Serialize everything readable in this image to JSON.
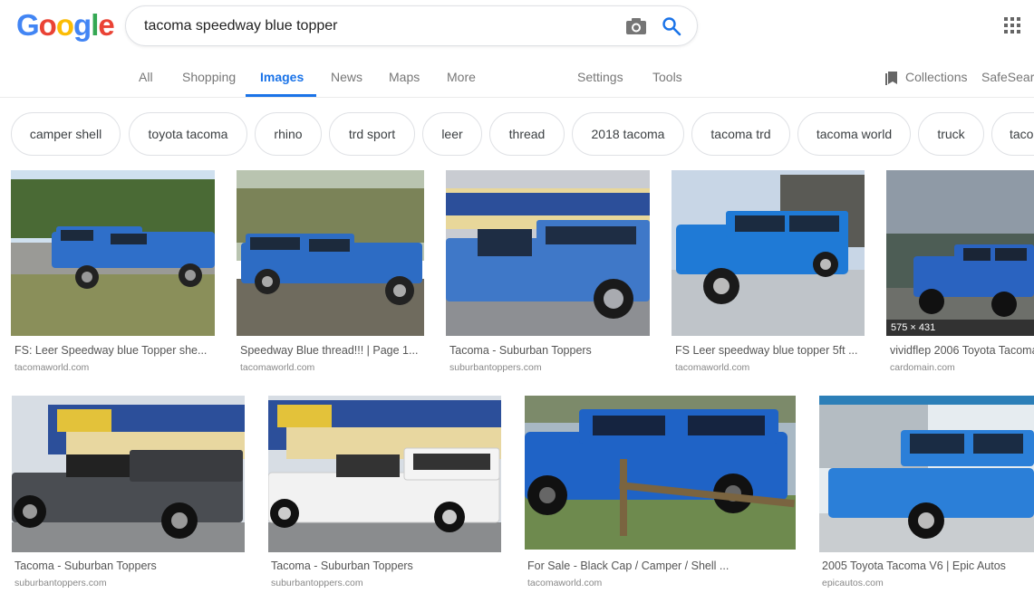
{
  "logo": {
    "letters": [
      "G",
      "o",
      "o",
      "g",
      "l",
      "e"
    ],
    "colors": [
      "#4285F4",
      "#EA4335",
      "#FBBC05",
      "#4285F4",
      "#34A853",
      "#EA4335"
    ]
  },
  "search": {
    "query": "tacoma speedway blue topper"
  },
  "tabs": {
    "all": "All",
    "shopping": "Shopping",
    "images": "Images",
    "news": "News",
    "maps": "Maps",
    "more": "More",
    "settings": "Settings",
    "tools": "Tools",
    "collections": "Collections",
    "safesearch": "SafeSearc"
  },
  "chips": [
    "camper shell",
    "toyota tacoma",
    "rhino",
    "trd sport",
    "leer",
    "thread",
    "2018 tacoma",
    "tacoma trd",
    "tacoma world",
    "truck",
    "taco"
  ],
  "results": [
    {
      "title": "FS: Leer Speedway blue Topper she...",
      "site": "tacomaworld.com",
      "truck": "#2f6fc9",
      "sky": "#cfe0ef",
      "ground": "#8a8f5a"
    },
    {
      "title": "Speedway Blue thread!!! | Page 1...",
      "site": "tacomaworld.com",
      "truck": "#2d6cc4",
      "sky": "#b9c4b0",
      "ground": "#6f6b5e"
    },
    {
      "title": "Tacoma - Suburban Toppers",
      "site": "suburbantoppers.com",
      "truck": "#3f78c8",
      "sky": "#c9ccd2",
      "ground": "#8d8f93"
    },
    {
      "title": "FS Leer speedway blue topper 5ft ...",
      "site": "tacomaworld.com",
      "truck": "#1f7ad6",
      "sky": "#c8d6e6",
      "ground": "#bfc4c9"
    },
    {
      "title": "vividflep 2006 Toyota Tacoma",
      "site": "cardomain.com",
      "truck": "#2a63c0",
      "sky": "#8f9aa6",
      "ground": "#4d5d55",
      "dims": "575 × 431"
    },
    {
      "title": "Tacoma - Suburban Toppers",
      "site": "suburbantoppers.com",
      "truck": "#4a4d52",
      "sky": "#d7dde4",
      "ground": "#8a8c8e"
    },
    {
      "title": "Tacoma - Suburban Toppers",
      "site": "suburbantoppers.com",
      "truck": "#f2f2f2",
      "sky": "#d7dde4",
      "ground": "#8a8c8e"
    },
    {
      "title": "For Sale - Black Cap / Camper / Shell ...",
      "site": "tacomaworld.com",
      "truck": "#1f63c6",
      "sky": "#a8b8c4",
      "ground": "#6e8a4e"
    },
    {
      "title": "2005 Toyota Tacoma V6 | Epic Autos",
      "site": "epicautos.com",
      "truck": "#2b7fd8",
      "sky": "#e6ecf0",
      "ground": "#c9cdd0"
    }
  ]
}
